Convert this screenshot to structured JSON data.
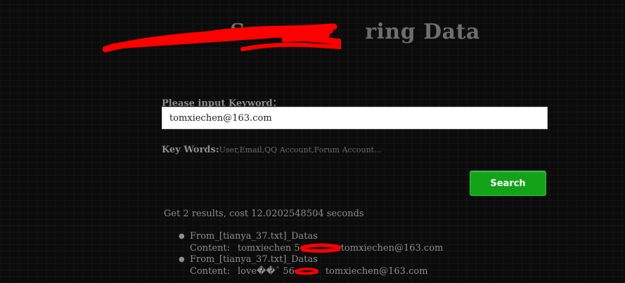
{
  "header": {
    "title_prefix": "S",
    "title_suffix": "ring Data"
  },
  "search": {
    "label": "Please input Keyword：",
    "value": "tomxiechen@163.com",
    "keywords_label": "Key Words:",
    "keywords_text": "User,Email,QQ Account,Forum Account...",
    "button_label": "Search"
  },
  "results": {
    "summary": "Get 2 results, cost 12.0202548504 seconds",
    "items": [
      {
        "source": "From_[tianya_37.txt]_Datas",
        "content_label": "Content:",
        "content_before": "tomxiechen 5",
        "content_after": "tomxiechen@163.com"
      },
      {
        "source": "From_[tianya_37.txt]_Datas",
        "content_label": "Content:",
        "content_before": "love��ˆ 56",
        "content_after": "tomxiechen@163.com"
      }
    ]
  },
  "colors": {
    "background": "#0b0b0b",
    "title": "#6e6e6e",
    "text": "#8d8d8d",
    "button": "#12a319",
    "redaction": "#ff0000"
  }
}
